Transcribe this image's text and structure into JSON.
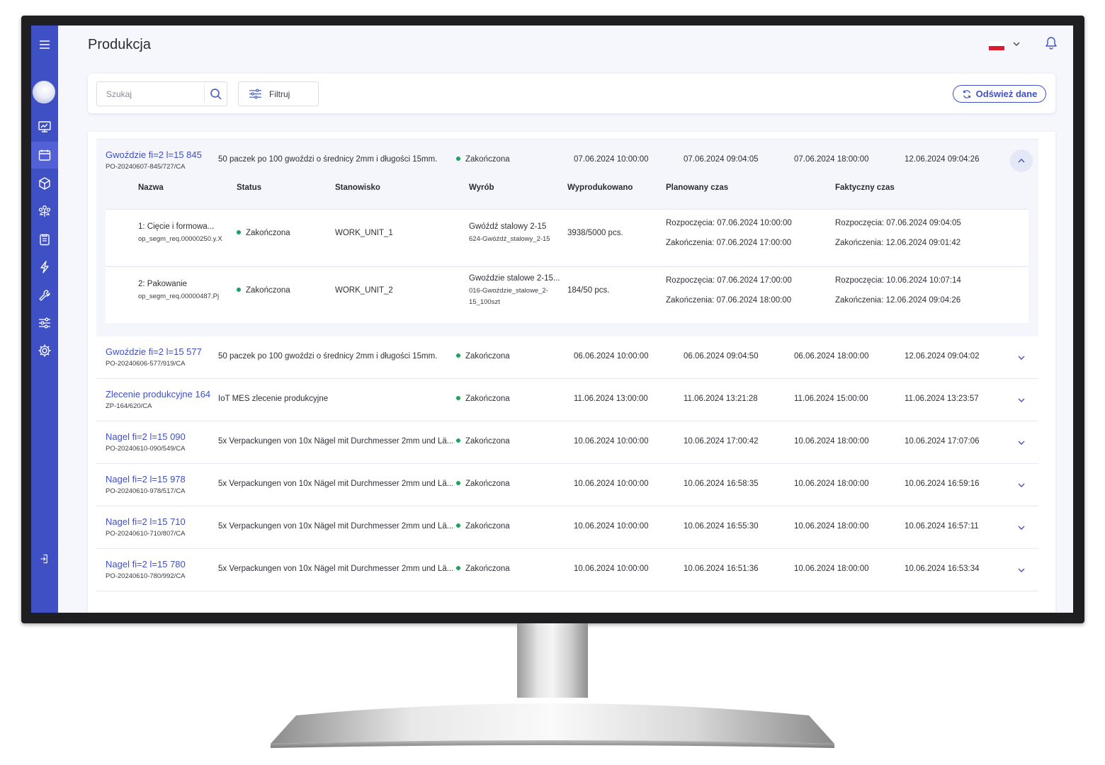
{
  "header": {
    "title": "Produkcja"
  },
  "toolbar": {
    "search_placeholder": "Szukaj",
    "filter_label": "Filtruj",
    "refresh_label": "Odśwież dane"
  },
  "sidebar": {
    "items": [
      "menu-icon",
      "monitor-chart-icon",
      "calendar-icon",
      "cube-icon",
      "people-icon",
      "clipboard-icon",
      "lightning-icon",
      "wrench-icon",
      "sliders-icon",
      "gear-icon",
      "logout-icon"
    ],
    "active": "calendar-icon",
    "accent": "#3f4fc4"
  },
  "colors": {
    "status_green": "#1aa35a",
    "link_blue": "#3f4fc4"
  },
  "orders": [
    {
      "name": "Gwoździe fi=2 l=15 845",
      "code": "PO-20240607-845/727/CA",
      "description": "50 paczek po 100 gwoździ o średnicy 2mm i długości 15mm.",
      "status": "Zakończona",
      "planned_start": "07.06.2024 10:00:00",
      "actual_start": "07.06.2024 09:04:05",
      "planned_end": "07.06.2024 18:00:00",
      "actual_end": "12.06.2024 09:04:26"
    },
    {
      "name": "Gwoździe fi=2 l=15 577",
      "code": "PO-20240606-577/919/CA",
      "description": "50 paczek po 100 gwoździ o średnicy 2mm i długości 15mm.",
      "status": "Zakończona",
      "planned_start": "06.06.2024 10:00:00",
      "actual_start": "06.06.2024 09:04:50",
      "planned_end": "06.06.2024 18:00:00",
      "actual_end": "12.06.2024 09:04:02"
    },
    {
      "name": "Zlecenie produkcyjne 164",
      "code": "ZP-164/620/CA",
      "description": "IoT MES zlecenie produkcyjne",
      "status": "Zakończona",
      "planned_start": "11.06.2024 13:00:00",
      "actual_start": "11.06.2024 13:21:28",
      "planned_end": "11.06.2024 15:00:00",
      "actual_end": "11.06.2024 13:23:57"
    },
    {
      "name": "Nagel fi=2 l=15 090",
      "code": "PO-20240610-090/549/CA",
      "description": "5x Verpackungen von 10x Nägel mit Durchmesser 2mm und Lä...",
      "status": "Zakończona",
      "planned_start": "10.06.2024 10:00:00",
      "actual_start": "10.06.2024 17:00:42",
      "planned_end": "10.06.2024 18:00:00",
      "actual_end": "10.06.2024 17:07:06"
    },
    {
      "name": "Nagel fi=2 l=15 978",
      "code": "PO-20240610-978/517/CA",
      "description": "5x Verpackungen von 10x Nägel mit Durchmesser 2mm und Lä...",
      "status": "Zakończona",
      "planned_start": "10.06.2024 10:00:00",
      "actual_start": "10.06.2024 16:58:35",
      "planned_end": "10.06.2024 18:00:00",
      "actual_end": "10.06.2024 16:59:16"
    },
    {
      "name": "Nagel fi=2 l=15 710",
      "code": "PO-20240610-710/807/CA",
      "description": "5x Verpackungen von 10x Nägel mit Durchmesser 2mm und Lä...",
      "status": "Zakończona",
      "planned_start": "10.06.2024 10:00:00",
      "actual_start": "10.06.2024 16:55:30",
      "planned_end": "10.06.2024 18:00:00",
      "actual_end": "10.06.2024 16:57:11"
    },
    {
      "name": "Nagel fi=2 l=15 780",
      "code": "PO-20240610-780/992/CA",
      "description": "5x Verpackungen von 10x Nägel mit Durchmesser 2mm und Lä...",
      "status": "Zakończona",
      "planned_start": "10.06.2024 10:00:00",
      "actual_start": "10.06.2024 16:51:36",
      "planned_end": "10.06.2024 18:00:00",
      "actual_end": "10.06.2024 16:53:34"
    }
  ],
  "operations_header": {
    "name": "Nazwa",
    "status": "Status",
    "workstation": "Stanowisko",
    "product": "Wyrób",
    "produced": "Wyprodukowano",
    "planned_time": "Planowany czas",
    "actual_time": "Faktyczny czas"
  },
  "operations": [
    {
      "name": "1: Cięcie i formowa...",
      "code": "op_segm_req.00000250.y.X",
      "status": "Zakończona",
      "workstation": "WORK_UNIT_1",
      "product": "Gwóźdź stalowy 2-15",
      "product_code_1": "624-Gwóźdź_stalowy_2-15",
      "product_code_2": "",
      "produced": "3938/5000 pcs.",
      "planned_start": "Rozpoczęcia: 07.06.2024 10:00:00",
      "planned_end": "Zakończenia: 07.06.2024 17:00:00",
      "actual_start": "Rozpoczęcia: 07.06.2024 09:04:05",
      "actual_end": "Zakończenia: 12.06.2024 09:01:42"
    },
    {
      "name": "2: Pakowanie",
      "code": "op_segm_req.00000487.Pj",
      "status": "Zakończona",
      "workstation": "WORK_UNIT_2",
      "product": "Gwoździe stalowe 2-15...",
      "product_code_1": "016-Gwoździe_stalowe_2-",
      "product_code_2": "15_100szt",
      "produced": "184/50 pcs.",
      "planned_start": "Rozpoczęcia: 07.06.2024 17:00:00",
      "planned_end": "Zakończenia: 07.06.2024 18:00:00",
      "actual_start": "Rozpoczęcia: 10.06.2024 10:07:14",
      "actual_end": "Zakończenia: 12.06.2024 09:04:26"
    }
  ]
}
